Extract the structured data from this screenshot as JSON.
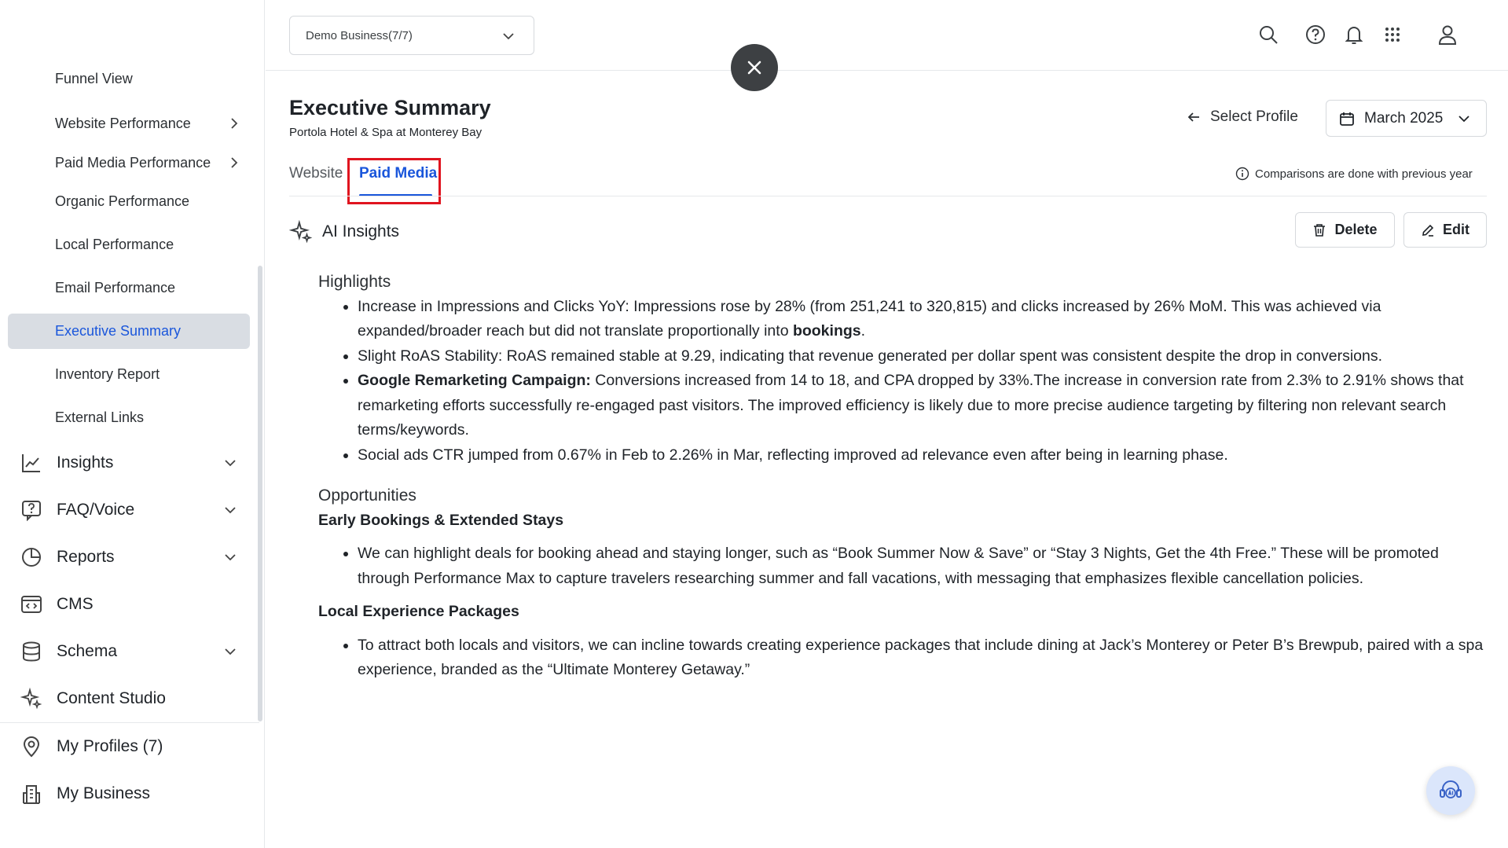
{
  "header": {
    "business_select": "Demo Business(7/7)"
  },
  "sidebar": {
    "sub_items": [
      {
        "label": "Funnel View"
      },
      {
        "label": "Website Performance",
        "has_chevron": true
      },
      {
        "label": "Paid Media Performance",
        "has_chevron": true
      },
      {
        "label": "Organic Performance"
      },
      {
        "label": "Local Performance"
      },
      {
        "label": "Email Performance"
      },
      {
        "label": "Executive Summary",
        "active": true
      },
      {
        "label": "Inventory Report"
      },
      {
        "label": "External Links"
      }
    ],
    "main_items": [
      {
        "label": "Insights",
        "icon": "chart-line-icon"
      },
      {
        "label": "FAQ/Voice",
        "icon": "question-bubble-icon"
      },
      {
        "label": "Reports",
        "icon": "pie-chart-icon"
      },
      {
        "label": "CMS",
        "icon": "code-window-icon"
      },
      {
        "label": "Schema",
        "icon": "database-icon"
      },
      {
        "label": "Content Studio",
        "icon": "sparkles-icon"
      }
    ],
    "bottom_items": [
      {
        "label": "My Profiles (7)",
        "icon": "location-pin-icon"
      },
      {
        "label": "My Business",
        "icon": "building-icon"
      }
    ]
  },
  "page": {
    "title": "Executive Summary",
    "subtitle": "Portola Hotel & Spa at Monterey Bay",
    "select_profile": "Select Profile",
    "month": "March 2025",
    "comparisons_note": "Comparisons are done with previous year"
  },
  "tabs": [
    {
      "label": "Website"
    },
    {
      "label": "Paid Media",
      "active": true
    }
  ],
  "ai_insights": {
    "title": "AI Insights",
    "delete_label": "Delete",
    "edit_label": "Edit",
    "highlights_heading": "Highlights",
    "highlights": [
      {
        "pre": "Increase in Impressions and Clicks YoY: Impressions rose by 28% (from 251,241 to 320,815) and clicks increased by 26% MoM. This was achieved via expanded/broader reach but did not translate proportionally into ",
        "bold": "bookings",
        "post": "."
      },
      {
        "pre": "Slight RoAS Stability: RoAS remained stable at 9.29, indicating that revenue generated per dollar spent was consistent despite the drop in conversions.",
        "bold": "",
        "post": ""
      },
      {
        "pre": "",
        "bold": "Google Remarketing Campaign:",
        "post": " Conversions increased from 14 to 18, and CPA dropped by 33%.The increase in conversion rate from 2.3% to 2.91% shows that remarketing efforts successfully re-engaged past visitors. The improved efficiency is likely due to more precise audience targeting by filtering non relevant search terms/keywords."
      },
      {
        "pre": "Social ads CTR jumped from 0.67% in Feb to 2.26% in Mar, reflecting improved ad relevance even after being in learning phase.",
        "bold": "",
        "post": ""
      }
    ],
    "opportunities_heading": "Opportunities",
    "opportunities": [
      {
        "title": "Early Bookings & Extended Stays",
        "text": " We can highlight deals for booking ahead and staying longer, such as “Book Summer Now & Save” or “Stay 3 Nights, Get the 4th Free.” These will be promoted through Performance Max to capture travelers researching summer and fall vacations, with messaging that emphasizes flexible cancellation policies."
      },
      {
        "title": "Local Experience Packages",
        "text": "To attract both locals and visitors, we can incline towards creating experience packages that include dining at Jack’s Monterey or Peter B’s Brewpub, paired with a spa experience, branded as the “Ultimate Monterey Getaway.”"
      }
    ]
  },
  "colors": {
    "accent": "#1a56db",
    "highlight_box": "#e0141f",
    "active_item_bg": "#d9dde3"
  }
}
